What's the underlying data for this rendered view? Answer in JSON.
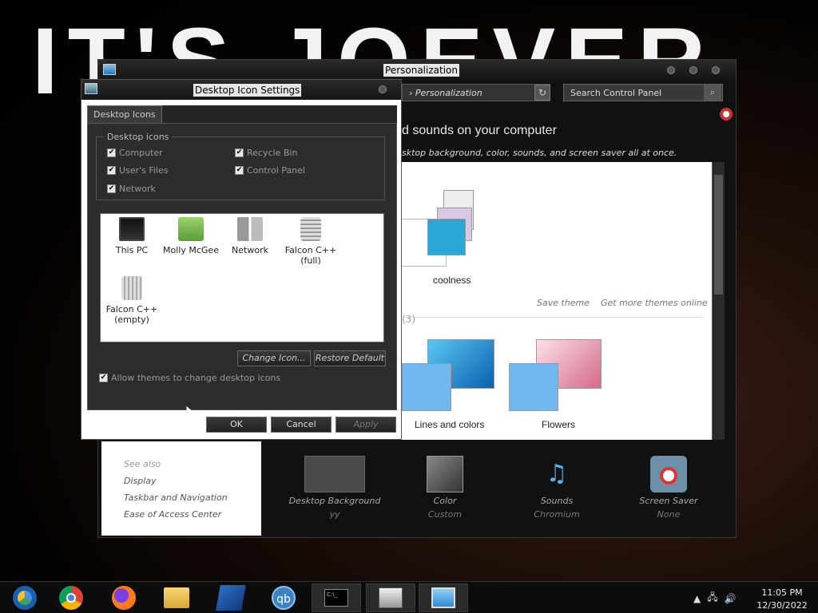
{
  "wallpaper": {
    "text": "IT'S JOEVER"
  },
  "personalization": {
    "title": "Personalization",
    "address": "› Personalization",
    "search_placeholder": "Search Control Panel",
    "heading": "d sounds on your computer",
    "subheading": "sktop background, color, sounds, and screen saver all at once.",
    "themes": [
      {
        "name": "coolness"
      },
      {
        "name": "Lines and colors"
      },
      {
        "name": "Flowers"
      }
    ],
    "save_theme": "Save theme",
    "get_more": "Get more themes online",
    "installed_count": "(3)",
    "see_also": {
      "title": "See also",
      "items": [
        "Display",
        "Taskbar and Navigation",
        "Ease of Access Center"
      ]
    },
    "bottom": [
      {
        "label": "Desktop Background",
        "value": "yy"
      },
      {
        "label": "Color",
        "value": "Custom"
      },
      {
        "label": "Sounds",
        "value": "Chromium"
      },
      {
        "label": "Screen Saver",
        "value": "None"
      }
    ]
  },
  "dialog": {
    "title": "Desktop Icon Settings",
    "tab": "Desktop Icons",
    "group_title": "Desktop icons",
    "checkboxes": {
      "computer": "Computer",
      "recycle_bin": "Recycle Bin",
      "users_files": "User's Files",
      "control_panel": "Control Panel",
      "network": "Network"
    },
    "icons": [
      {
        "label": "This PC"
      },
      {
        "label": "Molly McGee"
      },
      {
        "label": "Network"
      },
      {
        "label": "Falcon C++ (full)"
      },
      {
        "label": "Falcon C++ (empty)"
      }
    ],
    "change_icon": "Change Icon...",
    "restore_default": "Restore Default",
    "allow_themes": "Allow themes to change desktop icons",
    "ok": "OK",
    "cancel": "Cancel",
    "apply": "Apply",
    "check_mark": "✔"
  },
  "taskbar": {
    "time": "11:05 PM",
    "date": "12/30/2022",
    "apps": [
      "chromium-icon",
      "chrome-icon",
      "firefox-icon",
      "file-explorer-icon",
      "kdenlive-icon",
      "qbittorrent-icon",
      "terminal-icon",
      "control-panel-icon",
      "personalization-icon"
    ],
    "qb_label": "qb",
    "terminal_label": "C:\\_"
  }
}
